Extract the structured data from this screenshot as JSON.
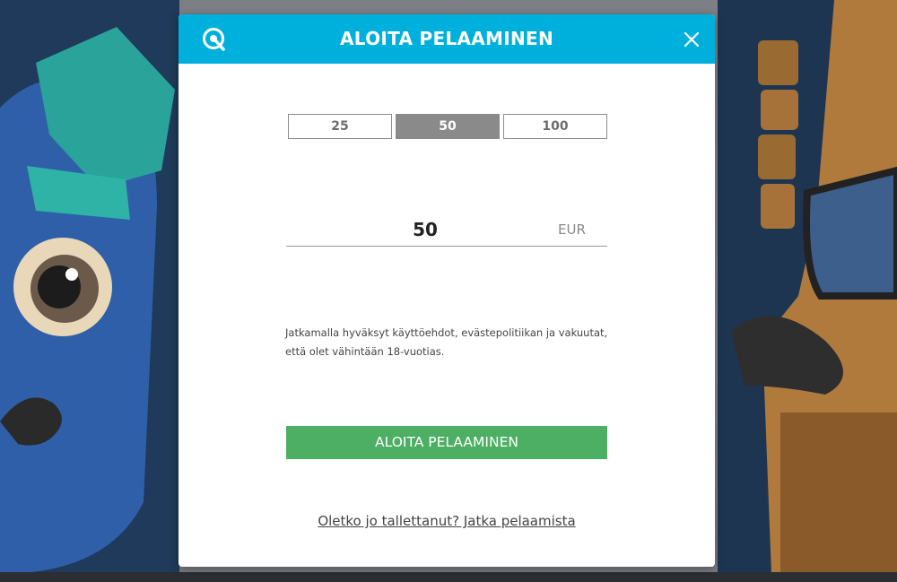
{
  "modal": {
    "title": "ALOITA PELAAMINEN",
    "close_icon": "close-icon",
    "brand_icon": "chat-bubble-logo-icon",
    "header_color": "#00b0dc"
  },
  "amount_options": [
    {
      "label": "25",
      "selected": false
    },
    {
      "label": "50",
      "selected": true
    },
    {
      "label": "100",
      "selected": false
    }
  ],
  "amount_input": {
    "value": "50",
    "currency": "EUR"
  },
  "terms_text": "Jatkamalla hyväksyt käyttöehdot, evästepolitiikan ja vakuutat, että olet vähintään 18-vuotias.",
  "cta": {
    "label": "ALOITA PELAAMINEN",
    "color": "#4caf63"
  },
  "continue_link": "Oletko jo tallettanut? Jatka pelaamista"
}
